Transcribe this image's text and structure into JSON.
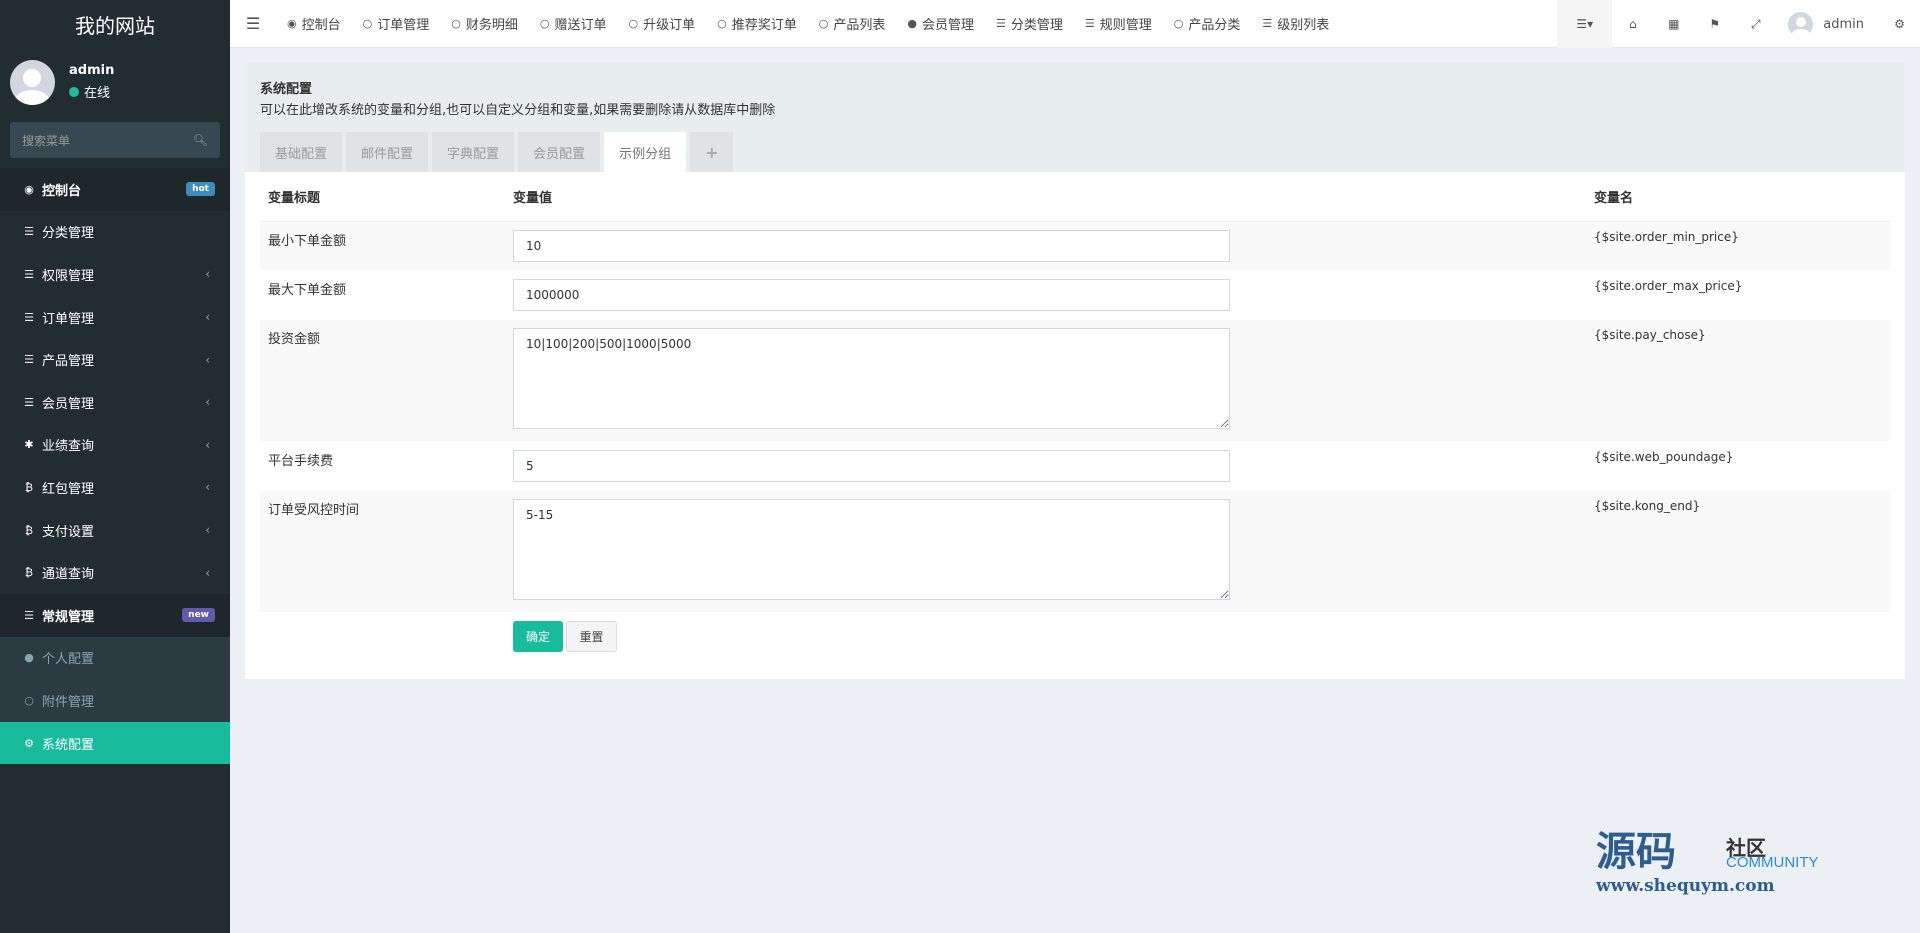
{
  "sidebar": {
    "logo": "我的网站",
    "user": {
      "name": "admin",
      "status": "在线"
    },
    "search_placeholder": "搜索菜单",
    "items": [
      {
        "label": "控制台",
        "badge": "hot"
      },
      {
        "label": "分类管理"
      },
      {
        "label": "权限管理",
        "chevron": "‹"
      },
      {
        "label": "订单管理",
        "chevron": "‹"
      },
      {
        "label": "产品管理",
        "chevron": "‹"
      },
      {
        "label": "会员管理",
        "chevron": "‹"
      },
      {
        "label": "业绩查询",
        "chevron": "‹"
      },
      {
        "label": "红包管理",
        "chevron": "‹"
      },
      {
        "label": "支付设置",
        "chevron": "‹"
      },
      {
        "label": "通道查询",
        "chevron": "‹"
      },
      {
        "label": "常规管理",
        "badge": "new"
      }
    ],
    "subitems": [
      {
        "label": "个人配置"
      },
      {
        "label": "附件管理"
      },
      {
        "label": "系统配置"
      }
    ]
  },
  "topnav": [
    {
      "label": "控制台"
    },
    {
      "label": "订单管理"
    },
    {
      "label": "财务明细"
    },
    {
      "label": "赠送订单"
    },
    {
      "label": "升级订单"
    },
    {
      "label": "推荐奖订单"
    },
    {
      "label": "产品列表"
    },
    {
      "label": "会员管理"
    },
    {
      "label": "分类管理"
    },
    {
      "label": "规则管理"
    },
    {
      "label": "产品分类"
    },
    {
      "label": "级别列表"
    }
  ],
  "topbar_user": "admin",
  "panel": {
    "title": "系统配置",
    "description": "可以在此增改系统的变量和分组,也可以自定义分组和变量,如果需要删除请从数据库中删除",
    "tabs": [
      "基础配置",
      "邮件配置",
      "字典配置",
      "会员配置",
      "示例分组",
      "+"
    ],
    "headers": [
      "变量标题",
      "变量值",
      "变量名"
    ],
    "rows": [
      {
        "title": "最小下单金额",
        "value": "10",
        "name": "{$site.order_min_price}"
      },
      {
        "title": "最大下单金额",
        "value": "1000000",
        "name": "{$site.order_max_price}"
      },
      {
        "title": "投资金额",
        "value": "10|100|200|500|1000|5000",
        "name": "{$site.pay_chose}"
      },
      {
        "title": "平台手续费",
        "value": "5",
        "name": "{$site.web_poundage}"
      },
      {
        "title": "订单受风控时间",
        "value": "5-15",
        "name": "{$site.kong_end}"
      }
    ],
    "confirm": "确定",
    "reset": "重置"
  },
  "watermark": {
    "big": "源码",
    "small": "社区",
    "community": "COMMUNITY",
    "url": "www.shequym.com"
  }
}
